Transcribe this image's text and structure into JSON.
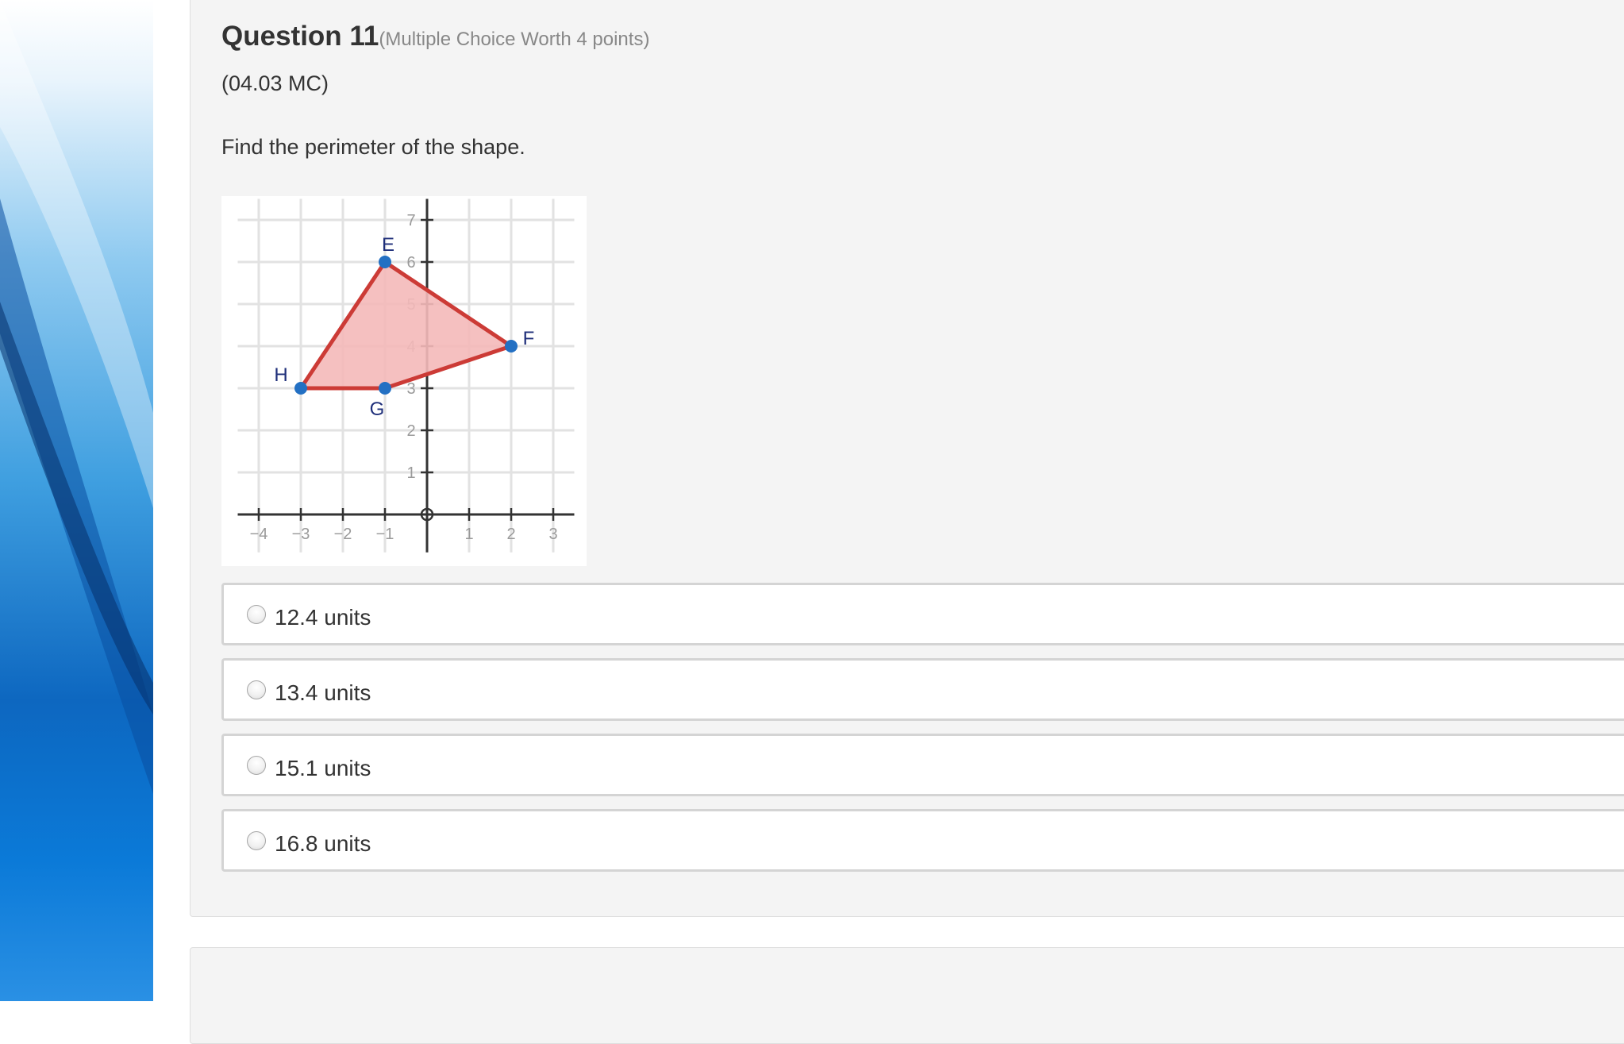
{
  "question": {
    "title": "Question 11",
    "meta": "(Multiple Choice Worth 4 points)",
    "code": "(04.03 MC)",
    "prompt": "Find the perimeter of the shape."
  },
  "figure": {
    "x_ticks": [
      "−4",
      "−3",
      "−2",
      "−1",
      "1",
      "2",
      "3"
    ],
    "y_ticks": [
      "1",
      "2",
      "3",
      "4",
      "5",
      "6",
      "7"
    ],
    "vertices": [
      {
        "label": "E",
        "x": -1,
        "y": 6
      },
      {
        "label": "F",
        "x": 2,
        "y": 4
      },
      {
        "label": "G",
        "x": -1,
        "y": 3
      },
      {
        "label": "H",
        "x": -3,
        "y": 3
      }
    ],
    "colors": {
      "fill": "#f4b9b9",
      "stroke": "#cc3b36",
      "point": "#2370c3",
      "label": "#1f2f7a"
    }
  },
  "choices": [
    {
      "label": "12.4 units"
    },
    {
      "label": "13.4 units"
    },
    {
      "label": "15.1 units"
    },
    {
      "label": "16.8 units"
    }
  ]
}
